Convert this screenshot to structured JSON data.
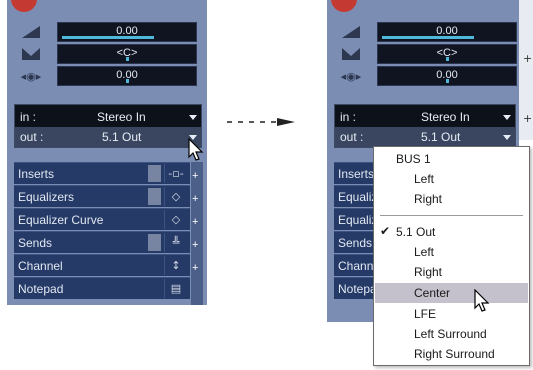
{
  "left": {
    "volume": "0.00",
    "pan": "<C>",
    "delay": "0.00",
    "input": {
      "label": "in :",
      "value": "Stereo In"
    },
    "output": {
      "label": "out :",
      "value": "5.1 Out"
    },
    "sections": [
      {
        "label": "Inserts",
        "icon": "-▫-"
      },
      {
        "label": "Equalizers",
        "icon": "◇"
      },
      {
        "label": "Equalizer Curve",
        "icon": "◇"
      },
      {
        "label": "Sends",
        "icon": "╩"
      },
      {
        "label": "Channel",
        "icon": "↕"
      },
      {
        "label": "Notepad",
        "icon": "▤"
      }
    ]
  },
  "right": {
    "volume": "0.00",
    "pan": "<C>",
    "delay": "0.00",
    "input": {
      "label": "in :",
      "value": "Stereo In"
    },
    "output": {
      "label": "out :",
      "value": "5.1 Out"
    },
    "sections": [
      {
        "label": "Inserts"
      },
      {
        "label": "Equaliz"
      },
      {
        "label": "Equaliz"
      },
      {
        "label": "Sends"
      },
      {
        "label": "Chann"
      },
      {
        "label": "Notepa"
      }
    ]
  },
  "menu": {
    "group1": {
      "title": "BUS 1",
      "items": [
        "Left",
        "Right"
      ]
    },
    "group2": {
      "title": "5.1 Out",
      "items": [
        "Left",
        "Right",
        "Center",
        "LFE",
        "Left Surround",
        "Right Surround"
      ]
    },
    "checked": "5.1 Out",
    "selected": "Center"
  },
  "colors": {
    "panel": "#7c8db4",
    "section": "#253a66",
    "meter": "#4fb8d8",
    "menu_highlight": "#c4c0cc"
  }
}
